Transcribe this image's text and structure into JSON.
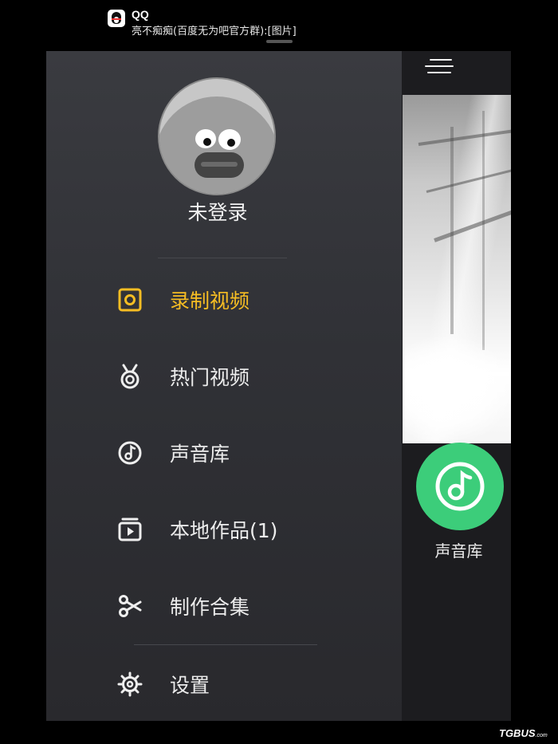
{
  "notification": {
    "app": "QQ",
    "message": "亮不痴痴(百度无为吧官方群):[图片]",
    "icon": "qq-penguin-icon"
  },
  "drawer": {
    "avatar_icon": "default-avatar-icon",
    "login_status": "未登录",
    "active_color": "#f6bd23",
    "items": [
      {
        "label": "录制视频",
        "icon": "record-video-icon",
        "active": true
      },
      {
        "label": "热门视频",
        "icon": "medal-icon",
        "active": false
      },
      {
        "label": "声音库",
        "icon": "music-note-icon",
        "active": false
      },
      {
        "label": "本地作品(1)",
        "icon": "local-works-icon",
        "active": false
      },
      {
        "label": "制作合集",
        "icon": "scissors-icon",
        "active": false
      },
      {
        "label": "设置",
        "icon": "gear-icon",
        "active": false
      }
    ]
  },
  "main": {
    "menu_icon": "hamburger-menu-icon",
    "music_button": {
      "label": "声音库",
      "icon": "music-note-icon",
      "color": "#3ccd7a"
    }
  },
  "watermark": {
    "brand": "TGBUS",
    "suffix": ".com"
  }
}
